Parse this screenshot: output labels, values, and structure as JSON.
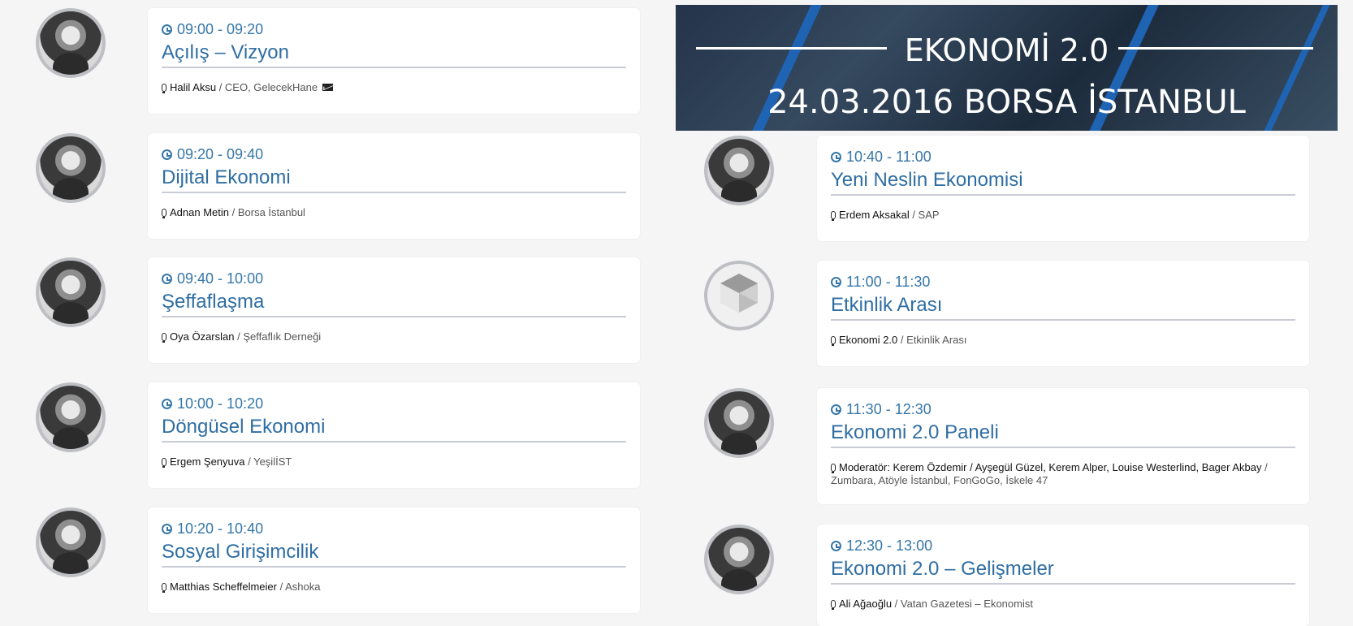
{
  "banner": {
    "title": "EKONOMİ 2.0",
    "subtitle": "24.03.2016 BORSA İSTANBUL"
  },
  "left": [
    {
      "time": "09:00 - 09:20",
      "title": "Açılış – Vizyon",
      "speaker": "Halil Aksu",
      "affiliation": " / CEO, GelecekHane",
      "email_icon": "envelope-icon"
    },
    {
      "time": "09:20 - 09:40",
      "title": "Dijital Ekonomi",
      "speaker": "Adnan Metin",
      "affiliation": " / Borsa İstanbul"
    },
    {
      "time": "09:40 - 10:00",
      "title": "Şeffaflaşma",
      "speaker": "Oya Özarslan",
      "affiliation": " / Şeffaflık Derneği"
    },
    {
      "time": "10:00 - 10:20",
      "title": "Döngüsel Ekonomi",
      "speaker": "Ergem Şenyuva",
      "affiliation": " / YeşilİST"
    },
    {
      "time": "10:20 - 10:40",
      "title": "Sosyal Girişimcilik",
      "speaker": "Matthias Scheffelmeier",
      "affiliation": " / Ashoka"
    }
  ],
  "right": [
    {
      "time": "10:40 - 11:00",
      "title": "Yeni Neslin Ekonomisi",
      "speaker": "Erdem Aksakal",
      "affiliation": " / SAP"
    },
    {
      "time": "11:00 - 11:30",
      "title": "Etkinlik Arası",
      "speaker": "Ekonomi 2.0",
      "affiliation": " / Etkinlik Arası"
    },
    {
      "time": "11:30 - 12:30",
      "title": "Ekonomi 2.0 Paneli",
      "speaker": "Moderatör: Kerem Özdemir / Ayşegül Güzel, Kerem Alper, Louise Westerlind, Bager Akbay",
      "affiliation": " / Zumbara, Atöyle İstanbul, FonGoGo, İskele 47"
    },
    {
      "time": "12:30 - 13:00",
      "title": "Ekonomi 2.0 – Gelişmeler",
      "speaker": "Ali Ağaoğlu",
      "affiliation": " / Vatan Gazetesi – Ekonomist"
    }
  ],
  "colors": {
    "accent": "#2f6ea3",
    "time": "#3677a8",
    "background": "#f5f5f5",
    "divider": "#c9ccd6"
  },
  "icons": {
    "time": "clock-icon",
    "speaker": "microphone-icon"
  }
}
